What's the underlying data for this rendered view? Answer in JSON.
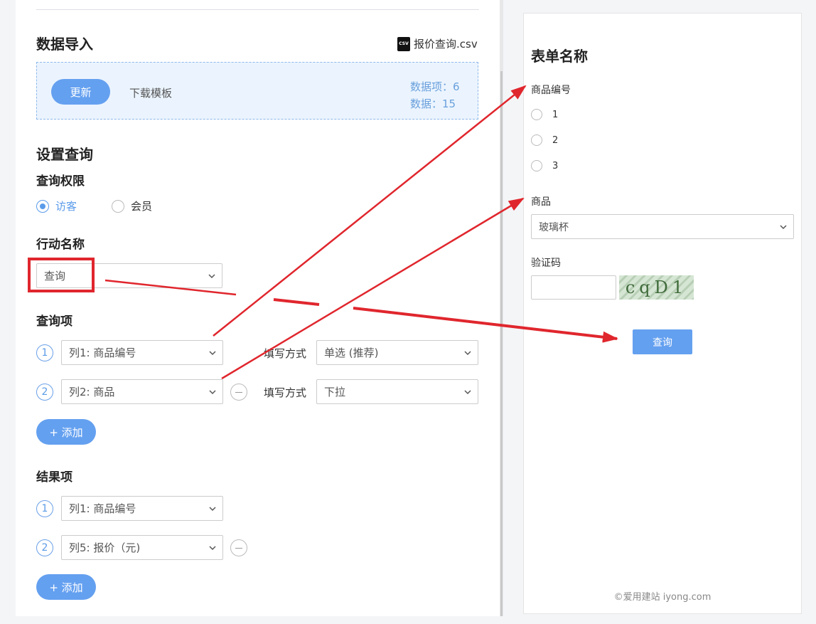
{
  "left": {
    "import": {
      "title": "数据导入",
      "file_icon_text": "CSV",
      "file_name": "报价查询.csv",
      "update_label": "更新",
      "download_label": "下载模板",
      "stat_items": "数据项：6",
      "stat_rows": "数据：15"
    },
    "setup": {
      "title": "设置查询",
      "permission_title": "查询权限",
      "permission_options": [
        "访客",
        "会员"
      ],
      "permission_selected": "访客",
      "action_title": "行动名称",
      "action_value": "查询",
      "query_items_title": "查询项",
      "fill_mode_label": "填写方式",
      "query_items": [
        {
          "num": "1",
          "column": "列1: 商品编号",
          "mode": "单选 (推荐)"
        },
        {
          "num": "2",
          "column": "列2: 商品",
          "mode": "下拉"
        }
      ],
      "add_label": "+ 添加",
      "result_items_title": "结果项",
      "result_items": [
        {
          "num": "1",
          "column": "列1: 商品编号"
        },
        {
          "num": "2",
          "column": "列5: 报价（元)"
        }
      ]
    }
  },
  "right": {
    "form_title": "表单名称",
    "field1_label": "商品编号",
    "field1_options": [
      "1",
      "2",
      "3"
    ],
    "field2_label": "商品",
    "field2_value": "玻璃杯",
    "captcha_label": "验证码",
    "captcha_text": "cqD1",
    "submit_label": "查询",
    "footer": "©爱用建站 iyong.com"
  },
  "colors": {
    "accent": "#64a0f0",
    "annotation": "#e0262d",
    "import_bg": "#ebf4fe"
  },
  "icons": [
    "csv-file-icon",
    "chevron-down-icon",
    "minus-circle-icon",
    "radio-icon"
  ]
}
